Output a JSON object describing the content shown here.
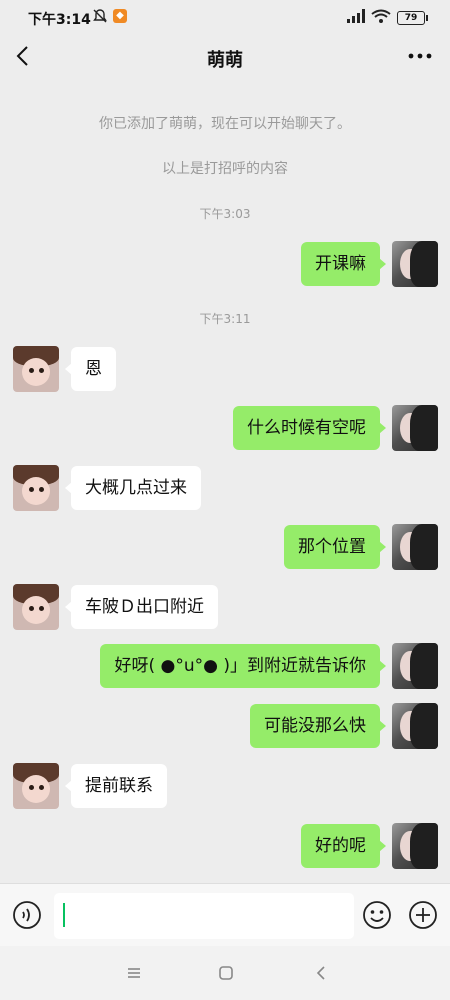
{
  "status_bar": {
    "time": "下午3:14",
    "battery": "79",
    "signal_icon": "signal-icon",
    "wifi_icon": "wifi-icon",
    "mute_icon": "bell-off-icon"
  },
  "header": {
    "title": "萌萌",
    "back_icon": "chevron-left-icon",
    "more_icon": "more-dots-icon"
  },
  "chat": {
    "system_notice": "你已添加了萌萌，现在可以开始聊天了。",
    "greeting_notice": "以上是打招呼的内容",
    "time_1": "下午3:03",
    "time_2": "下午3:11",
    "messages": [
      {
        "from": "me",
        "text": "开课嘛"
      },
      {
        "from": "her",
        "text": "恩"
      },
      {
        "from": "me",
        "text": "什么时候有空呢"
      },
      {
        "from": "her",
        "text": "大概几点过来"
      },
      {
        "from": "me",
        "text": "那个位置"
      },
      {
        "from": "her",
        "text": "车陂Ｄ出口附近"
      },
      {
        "from": "me",
        "text": "好呀( ●°u°● )」到附近就告诉你"
      },
      {
        "from": "me",
        "text": "可能没那么快"
      },
      {
        "from": "her",
        "text": "提前联系"
      },
      {
        "from": "me",
        "text": "好的呢"
      }
    ]
  },
  "input_bar": {
    "value": "",
    "voice_icon": "voice-icon",
    "emoji_icon": "emoji-icon",
    "plus_icon": "plus-circle-icon",
    "accent_color": "#07c160"
  },
  "colors": {
    "my_bubble": "#95ec69",
    "her_bubble": "#ffffff",
    "background": "#ededed"
  }
}
